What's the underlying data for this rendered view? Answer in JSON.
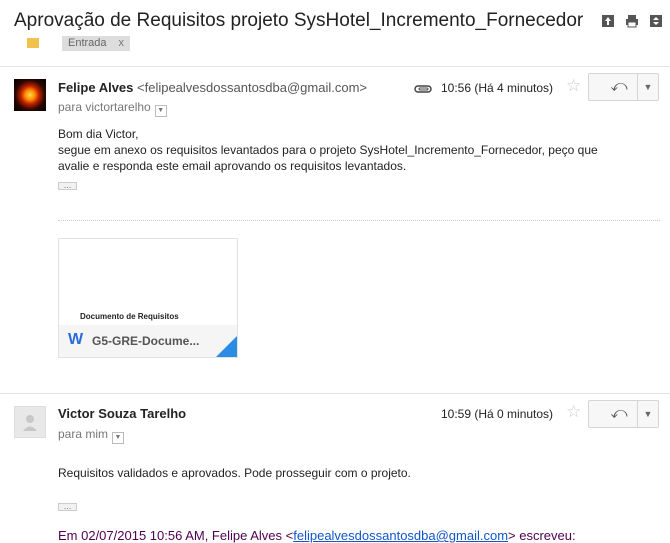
{
  "subject": "Aprovação de Requisitos projeto SysHotel_Incremento_Fornecedor",
  "labels": [
    {
      "name": "Entrada",
      "remove": "x"
    }
  ],
  "toolbar": {
    "icons": [
      "open-in-new-window-icon",
      "print-icon",
      "expand-all-icon"
    ]
  },
  "messages": [
    {
      "sender_name": "Felipe Alves",
      "sender_email": "<felipealvesdossantosdba@gmail.com>",
      "to": "para victortarelho",
      "time": "10:56 (Há 4 minutos)",
      "body_lines": [
        "Bom dia Victor,",
        "segue em anexo os requisitos levantados para o projeto SysHotel_Incremento_Fornecedor, peço que",
        "avalie e responda este email aprovando os requisitos levantados."
      ],
      "ellipsis": "...",
      "attachment": {
        "preview_title": "Documento de Requisitos",
        "filename": "G5-GRE-Docume...",
        "icon": "W"
      }
    },
    {
      "sender_name": "Victor Souza Tarelho",
      "to": "para mim",
      "time": "10:59 (Há 0 minutos)",
      "body": "Requisitos validados e aprovados. Pode prosseguir com o projeto.",
      "ellipsis": "...",
      "quote_prefix": "Em 02/07/2015 10:56 AM, Felipe Alves <",
      "quote_email": "felipealvesdossantosdba@gmail.com",
      "quote_suffix": "> escreveu:"
    }
  ],
  "colors": {
    "accent_blue": "#2b8ce6",
    "label_yellow": "#f2c14e",
    "quote_purple": "#500050",
    "link_blue": "#1155cc"
  }
}
